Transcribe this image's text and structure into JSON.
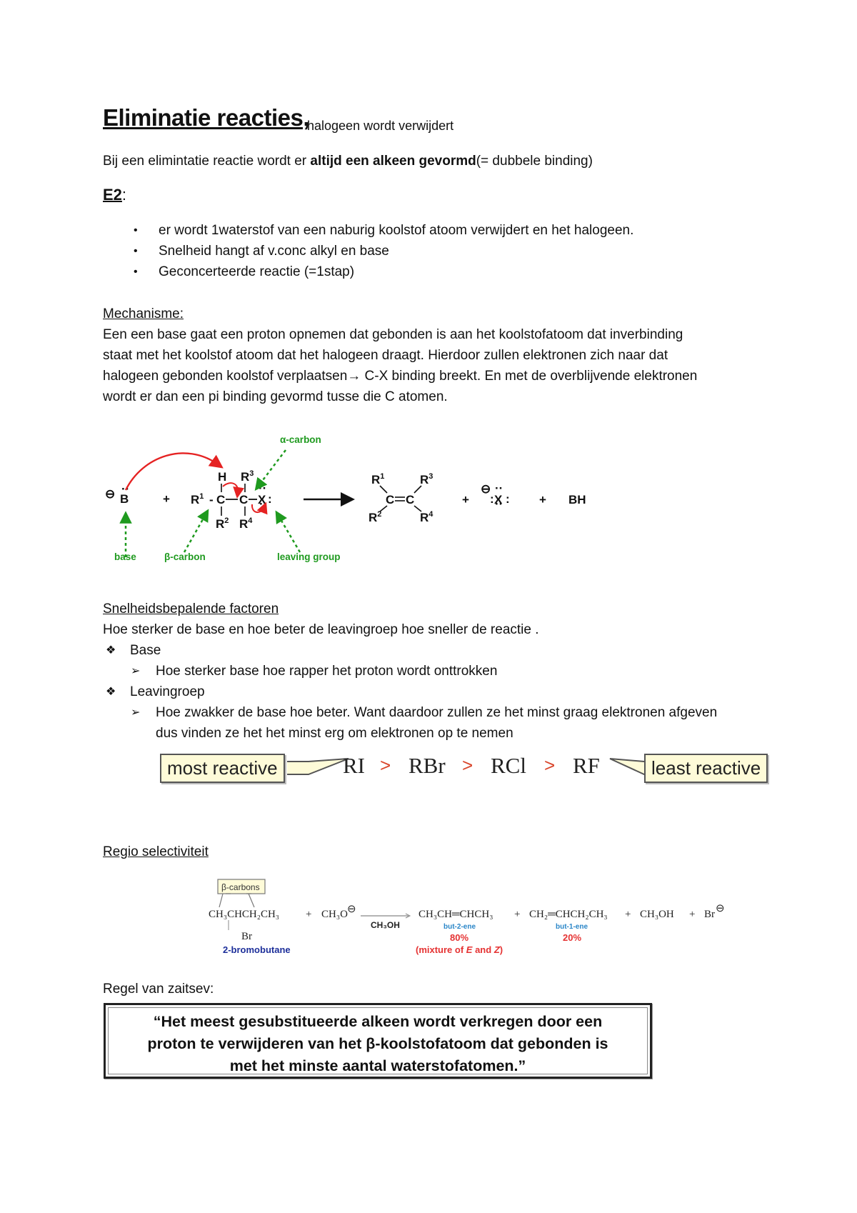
{
  "title": {
    "main": "Eliminatie reacties,",
    "sub": "halogeen wordt verwijdert"
  },
  "intro": {
    "before": "Bij een elimintatie reactie wordt er ",
    "bold": "altijd een alkeen gevormd",
    "after": "(= dubbele binding)"
  },
  "e2": {
    "heading": "E2",
    "colon": ":",
    "bullets": [
      "er wordt 1waterstof van een naburig koolstof atoom verwijdert en het halogeen.",
      "Snelheid hangt af v.conc alkyl en base",
      "Geconcerteerde reactie (=1stap)"
    ],
    "bullet_glyph": "•"
  },
  "mechanism": {
    "heading": "Mechanisme:",
    "lines": [
      "Een een base gaat een proton opnemen dat gebonden is aan het koolstofatoom dat inverbinding",
      "staat met het koolstof atoom dat het halogeen draagt.  Hierdoor zullen elektronen zich naar dat",
      "halogeen gebonden koolstof verplaatsen→ C-X binding breekt. En met de overblijvende elektronen",
      "wordt er dan een pi binding gevormd tusse die C atomen."
    ],
    "diagram": {
      "base_atom": "B",
      "charge": "⊖",
      "plus": "+",
      "H": "H",
      "C": "C",
      "X": "X",
      "R1": "R",
      "R1_sup": "1",
      "R2": "R",
      "R2_sup": "2",
      "R3": "R",
      "R3_sup": "3",
      "R4": "R",
      "R4_sup": "4",
      "BH": "BH",
      "labels": {
        "alpha": "α-carbon",
        "beta": "β-carbon",
        "base": "base",
        "leaving": "leaving group"
      },
      "colors": {
        "arrow_red": "#e52222",
        "label_green": "#1f9a1f"
      }
    }
  },
  "factors": {
    "heading": "Snelheidsbepalende factoren",
    "intro": "Hoe sterker de base en hoe beter de leavingroep hoe sneller de reactie .",
    "items": [
      {
        "label": "Base",
        "sub": [
          "Hoe sterker base hoe rapper het proton wordt onttrokken"
        ]
      },
      {
        "label": "Leavingroep",
        "sub": [
          "Hoe zwakker de base hoe beter. Want daardoor zullen ze het minst graag elektronen afgeven",
          "dus vinden ze het het minst erg om elektronen op te nemen"
        ]
      }
    ],
    "diamond_glyph": "❖",
    "arrow_glyph": "➢",
    "reactivity": {
      "most": "most reactive",
      "least": "least reactive",
      "order": [
        "RI",
        "RBr",
        "RCl",
        "RF"
      ],
      "sep": ">"
    }
  },
  "regio": {
    "heading": "Regio selectiviteit",
    "callout": "β-carbons",
    "reactant": "CH₃CHCH₂CH₃",
    "reactant_sub": "Br",
    "reactant_name": "2-bromobutane",
    "reagent": "CH₃O",
    "solvent": "CH₃OH",
    "product1": "CH₃CH═CHCH₃",
    "product1_name": "but-2-ene",
    "product1_pct": "80%",
    "product1_note_a": "(mixture of ",
    "product1_note_e": "E",
    "product1_note_b": " and ",
    "product1_note_z": "Z",
    "product1_note_c": ")",
    "product2": "CH₂═CHCH₂CH₃",
    "product2_name": "but-1-ene",
    "product2_pct": "20%",
    "product3": "CH₃OH",
    "product4": "Br",
    "plus": "+"
  },
  "zaitsev": {
    "heading": "Regel van zaitsev:",
    "quote": "“Het meest gesubstitueerde alkeen wordt verkregen door een\nproton te verwijderen van het β-koolstofatoom dat gebonden is\nmet het minste aantal waterstofatomen.”"
  }
}
